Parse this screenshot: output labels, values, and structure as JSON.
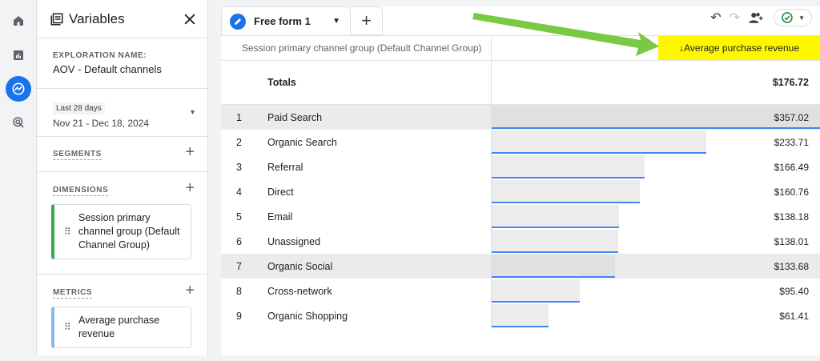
{
  "panel": {
    "title": "Variables",
    "exploration_label": "EXPLORATION NAME:",
    "exploration_name": "AOV - Default channels",
    "date_chip": "Last 28 days",
    "date_range": "Nov 21 - Dec 18, 2024",
    "segments_label": "SEGMENTS",
    "dimensions_label": "DIMENSIONS",
    "dimension_item": "Session primary channel group (Default Channel Group)",
    "metrics_label": "METRICS",
    "metric_item": "Average purchase revenue"
  },
  "tab": {
    "label": "Free form 1"
  },
  "table": {
    "dimension_header": "Session primary channel group (Default Channel Group)",
    "metric_header": "↓Average purchase revenue",
    "totals_label": "Totals",
    "totals_value": "$176.72",
    "rows": [
      {
        "idx": "1",
        "name": "Paid Search",
        "value": "$357.02",
        "num": 357.02
      },
      {
        "idx": "2",
        "name": "Organic Search",
        "value": "$233.71",
        "num": 233.71
      },
      {
        "idx": "3",
        "name": "Referral",
        "value": "$166.49",
        "num": 166.49
      },
      {
        "idx": "4",
        "name": "Direct",
        "value": "$160.76",
        "num": 160.76
      },
      {
        "idx": "5",
        "name": "Email",
        "value": "$138.18",
        "num": 138.18
      },
      {
        "idx": "6",
        "name": "Unassigned",
        "value": "$138.01",
        "num": 138.01
      },
      {
        "idx": "7",
        "name": "Organic Social",
        "value": "$133.68",
        "num": 133.68
      },
      {
        "idx": "8",
        "name": "Cross-network",
        "value": "$95.40",
        "num": 95.4
      },
      {
        "idx": "9",
        "name": "Organic Shopping",
        "value": "$61.41",
        "num": 61.41
      }
    ]
  },
  "colors": {
    "accent": "#1a73e8",
    "highlight": "#fff700",
    "arrow": "#7ac943"
  }
}
